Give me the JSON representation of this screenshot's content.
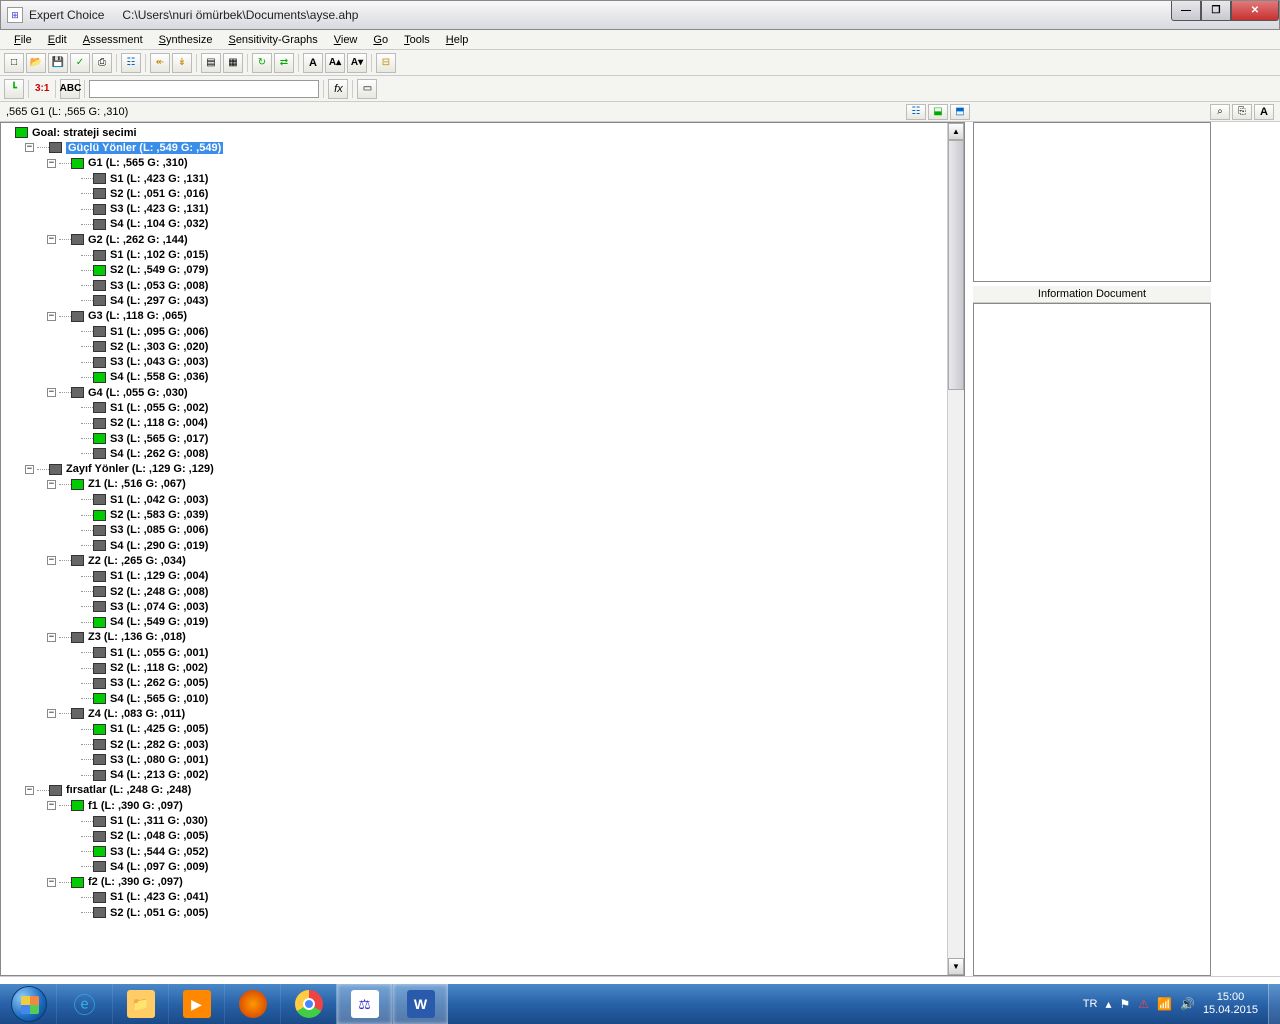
{
  "title": {
    "app": "Expert Choice",
    "path": "C:\\Users\\nuri ömürbek\\Documents\\ayse.ahp"
  },
  "menu": [
    "File",
    "Edit",
    "Assessment",
    "Synthesize",
    "Sensitivity-Graphs",
    "View",
    "Go",
    "Tools",
    "Help"
  ],
  "toolbar1": [
    "new",
    "open",
    "save",
    "print",
    "find",
    "copy",
    "tree",
    "left",
    "down",
    "a1",
    "a2",
    "fx1",
    "fx2",
    "bold",
    "Aplus",
    "Aminus",
    "brk",
    "grp"
  ],
  "toolbar2_label": "3:1",
  "toolbar2_btn": "ABC",
  "status_left": ",565  G1 (L: ,565 G: ,310)",
  "info_label": "Information Document",
  "tree": [
    {
      "d": 0,
      "exp": "",
      "c": "green",
      "t": "Goal: strateji secimi",
      "sel": false
    },
    {
      "d": 1,
      "exp": "-",
      "c": "dark",
      "t": "Güçlü Yönler (L: ,549 G: ,549)",
      "sel": true
    },
    {
      "d": 2,
      "exp": "-",
      "c": "green",
      "t": "G1 (L: ,565 G: ,310)"
    },
    {
      "d": 3,
      "exp": "",
      "c": "dark",
      "t": "S1 (L: ,423 G: ,131)"
    },
    {
      "d": 3,
      "exp": "",
      "c": "dark",
      "t": "S2 (L: ,051 G: ,016)"
    },
    {
      "d": 3,
      "exp": "",
      "c": "dark",
      "t": "S3 (L: ,423 G: ,131)"
    },
    {
      "d": 3,
      "exp": "",
      "c": "dark",
      "t": "S4 (L: ,104 G: ,032)"
    },
    {
      "d": 2,
      "exp": "-",
      "c": "dark",
      "t": "G2 (L: ,262 G: ,144)"
    },
    {
      "d": 3,
      "exp": "",
      "c": "dark",
      "t": "S1 (L: ,102 G: ,015)"
    },
    {
      "d": 3,
      "exp": "",
      "c": "green",
      "t": "S2 (L: ,549 G: ,079)"
    },
    {
      "d": 3,
      "exp": "",
      "c": "dark",
      "t": "S3 (L: ,053 G: ,008)"
    },
    {
      "d": 3,
      "exp": "",
      "c": "dark",
      "t": "S4 (L: ,297 G: ,043)"
    },
    {
      "d": 2,
      "exp": "-",
      "c": "dark",
      "t": "G3 (L: ,118 G: ,065)"
    },
    {
      "d": 3,
      "exp": "",
      "c": "dark",
      "t": "S1 (L: ,095 G: ,006)"
    },
    {
      "d": 3,
      "exp": "",
      "c": "dark",
      "t": "S2 (L: ,303 G: ,020)"
    },
    {
      "d": 3,
      "exp": "",
      "c": "dark",
      "t": "S3 (L: ,043 G: ,003)"
    },
    {
      "d": 3,
      "exp": "",
      "c": "green",
      "t": "S4 (L: ,558 G: ,036)"
    },
    {
      "d": 2,
      "exp": "-",
      "c": "dark",
      "t": "G4 (L: ,055 G: ,030)"
    },
    {
      "d": 3,
      "exp": "",
      "c": "dark",
      "t": "S1 (L: ,055 G: ,002)"
    },
    {
      "d": 3,
      "exp": "",
      "c": "dark",
      "t": "S2 (L: ,118 G: ,004)"
    },
    {
      "d": 3,
      "exp": "",
      "c": "green",
      "t": "S3 (L: ,565 G: ,017)"
    },
    {
      "d": 3,
      "exp": "",
      "c": "dark",
      "t": "S4 (L: ,262 G: ,008)"
    },
    {
      "d": 1,
      "exp": "-",
      "c": "dark",
      "t": "Zayıf Yönler (L: ,129 G: ,129)"
    },
    {
      "d": 2,
      "exp": "-",
      "c": "green",
      "t": "Z1 (L: ,516 G: ,067)"
    },
    {
      "d": 3,
      "exp": "",
      "c": "dark",
      "t": "S1 (L: ,042 G: ,003)"
    },
    {
      "d": 3,
      "exp": "",
      "c": "green",
      "t": "S2 (L: ,583 G: ,039)"
    },
    {
      "d": 3,
      "exp": "",
      "c": "dark",
      "t": "S3 (L: ,085 G: ,006)"
    },
    {
      "d": 3,
      "exp": "",
      "c": "dark",
      "t": "S4 (L: ,290 G: ,019)"
    },
    {
      "d": 2,
      "exp": "-",
      "c": "dark",
      "t": "Z2 (L: ,265 G: ,034)"
    },
    {
      "d": 3,
      "exp": "",
      "c": "dark",
      "t": "S1 (L: ,129 G: ,004)"
    },
    {
      "d": 3,
      "exp": "",
      "c": "dark",
      "t": "S2 (L: ,248 G: ,008)"
    },
    {
      "d": 3,
      "exp": "",
      "c": "dark",
      "t": "S3 (L: ,074 G: ,003)"
    },
    {
      "d": 3,
      "exp": "",
      "c": "green",
      "t": "S4 (L: ,549 G: ,019)"
    },
    {
      "d": 2,
      "exp": "-",
      "c": "dark",
      "t": "Z3 (L: ,136 G: ,018)"
    },
    {
      "d": 3,
      "exp": "",
      "c": "dark",
      "t": "S1 (L: ,055 G: ,001)"
    },
    {
      "d": 3,
      "exp": "",
      "c": "dark",
      "t": "S2 (L: ,118 G: ,002)"
    },
    {
      "d": 3,
      "exp": "",
      "c": "dark",
      "t": "S3 (L: ,262 G: ,005)"
    },
    {
      "d": 3,
      "exp": "",
      "c": "green",
      "t": "S4 (L: ,565 G: ,010)"
    },
    {
      "d": 2,
      "exp": "-",
      "c": "dark",
      "t": "Z4 (L: ,083 G: ,011)"
    },
    {
      "d": 3,
      "exp": "",
      "c": "green",
      "t": "S1 (L: ,425 G: ,005)"
    },
    {
      "d": 3,
      "exp": "",
      "c": "dark",
      "t": "S2 (L: ,282 G: ,003)"
    },
    {
      "d": 3,
      "exp": "",
      "c": "dark",
      "t": "S3 (L: ,080 G: ,001)"
    },
    {
      "d": 3,
      "exp": "",
      "c": "dark",
      "t": "S4 (L: ,213 G: ,002)"
    },
    {
      "d": 1,
      "exp": "-",
      "c": "dark",
      "t": "fırsatlar (L: ,248 G: ,248)"
    },
    {
      "d": 2,
      "exp": "-",
      "c": "green",
      "t": "f1 (L: ,390 G: ,097)"
    },
    {
      "d": 3,
      "exp": "",
      "c": "dark",
      "t": "S1 (L: ,311 G: ,030)"
    },
    {
      "d": 3,
      "exp": "",
      "c": "dark",
      "t": "S2 (L: ,048 G: ,005)"
    },
    {
      "d": 3,
      "exp": "",
      "c": "green",
      "t": "S3 (L: ,544 G: ,052)"
    },
    {
      "d": 3,
      "exp": "",
      "c": "dark",
      "t": "S4 (L: ,097 G: ,009)"
    },
    {
      "d": 2,
      "exp": "-",
      "c": "green",
      "t": "f2 (L: ,390 G: ,097)"
    },
    {
      "d": 3,
      "exp": "",
      "c": "dark",
      "t": "S1 (L: ,423 G: ,041)"
    },
    {
      "d": 3,
      "exp": "",
      "c": "dark",
      "t": "S2 (L: ,051 G: ,005)"
    }
  ],
  "tray": {
    "lang": "TR",
    "time": "15:00",
    "date": "15.04.2015"
  }
}
